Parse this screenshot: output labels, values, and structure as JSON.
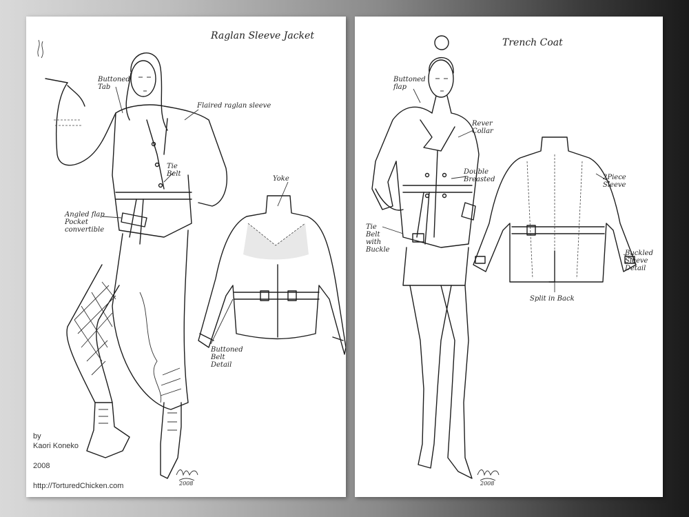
{
  "left_sheet": {
    "title": "Raglan Sleeve Jacket",
    "labels": {
      "buttoned_tab": "Buttoned\nTab",
      "flared_sleeve": "Flaired raglan sleeve",
      "tie_belt": "Tie\nBelt",
      "yoke": "Yoke",
      "angled_pocket": "Angled flap\nPocket\nconvertible",
      "buttoned_belt": "Buttoned\nBelt\nDetail"
    },
    "credit": {
      "by": "by",
      "artist": "Kaori Koneko",
      "year": "2008",
      "website": "http://TorturedChicken.com"
    },
    "signature": "2008"
  },
  "right_sheet": {
    "title": "Trench Coat",
    "labels": {
      "buttoned_flap": "Buttoned\nflap",
      "revere_collar": "Rever\nCollar",
      "double_breasted": "Double\nBreasted",
      "two_piece_sleeve": "2Piece\nSleeve",
      "tie_belt_buckle": "Tie\nBelt\nwith\nBuckle",
      "buckled_sleeve": "Buckled\nSleeve\nDetail",
      "split_back": "Split in Back"
    },
    "signature": "2008"
  }
}
